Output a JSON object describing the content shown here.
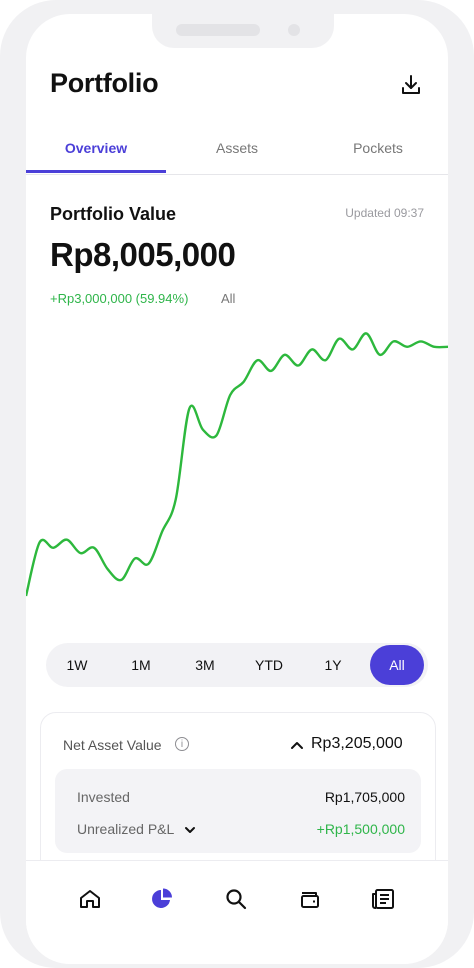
{
  "header": {
    "title": "Portfolio",
    "download_icon": "download-icon"
  },
  "tabs": [
    {
      "label": "Overview",
      "active": true
    },
    {
      "label": "Assets",
      "active": false
    },
    {
      "label": "Pockets",
      "active": false
    }
  ],
  "portfolio": {
    "label": "Portfolio Value",
    "updated": "Updated 09:37",
    "value": "Rp8,005,000",
    "change": "+Rp3,000,000 (59.94%)",
    "period": "All"
  },
  "colors": {
    "accent": "#4b3fd8",
    "gain": "#2fb54a",
    "line": "#2db83d"
  },
  "chart_data": {
    "type": "line",
    "title": "",
    "xlabel": "",
    "ylabel": "",
    "ylim": [
      0,
      100
    ],
    "values": [
      0,
      20,
      18,
      21,
      16,
      18,
      10,
      6,
      14,
      12,
      24,
      36,
      70,
      62,
      60,
      75,
      80,
      88,
      84,
      90,
      86,
      92,
      88,
      96,
      92,
      98,
      90,
      95,
      93,
      95,
      93,
      93
    ]
  },
  "ranges": [
    {
      "label": "1W",
      "active": false
    },
    {
      "label": "1M",
      "active": false
    },
    {
      "label": "3M",
      "active": false
    },
    {
      "label": "YTD",
      "active": false
    },
    {
      "label": "1Y",
      "active": false
    },
    {
      "label": "All",
      "active": true
    }
  ],
  "net_asset": {
    "label": "Net Asset Value",
    "value": "Rp3,205,000",
    "rows": [
      {
        "label": "Invested",
        "value": "Rp1,705,000"
      },
      {
        "label": "Unrealized P&L",
        "value": "+Rp1,500,000"
      }
    ]
  },
  "bottom_nav": [
    {
      "name": "home-icon"
    },
    {
      "name": "portfolio-pie-icon",
      "active": true
    },
    {
      "name": "search-icon"
    },
    {
      "name": "wallet-icon"
    },
    {
      "name": "news-icon"
    }
  ]
}
